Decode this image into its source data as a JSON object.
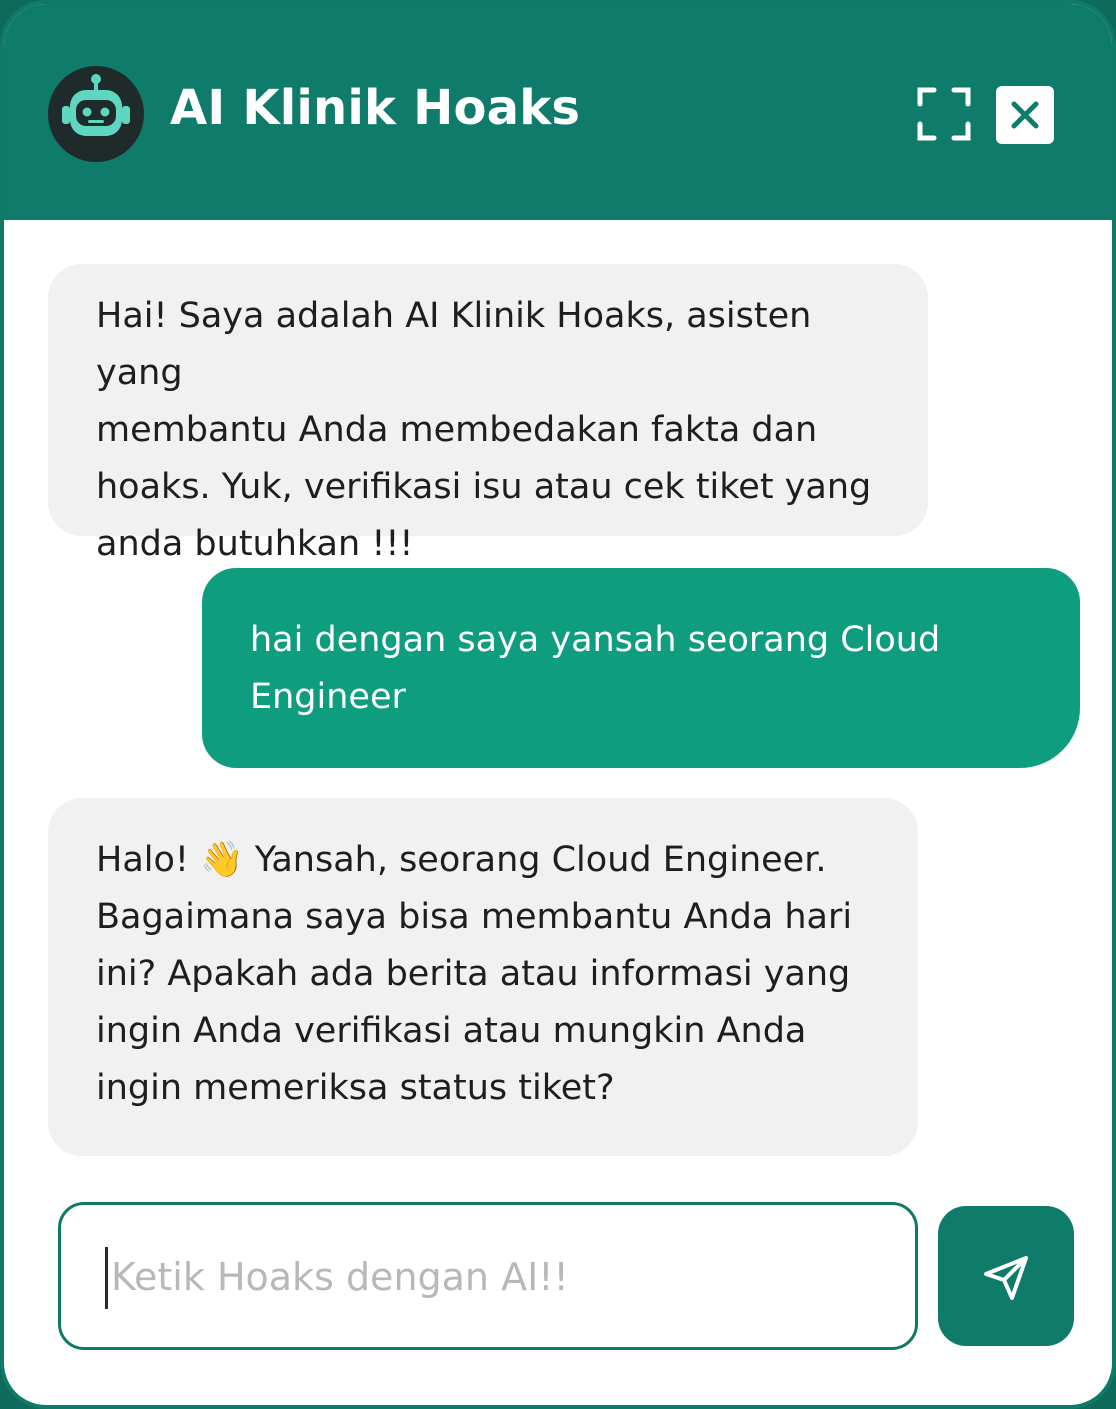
{
  "header": {
    "title": "AI Klinik Hoaks",
    "avatar_icon": "robot-icon",
    "expand_icon": "fullscreen-icon",
    "close_icon": "close-icon"
  },
  "messages": [
    {
      "role": "bot",
      "text": "Hai! Saya adalah AI Klinik Hoaks, asisten yang\nmembantu Anda membedakan fakta dan\nhoaks. Yuk, verifikasi isu atau cek tiket yang\nanda butuhkan !!!"
    },
    {
      "role": "user",
      "text": "hai dengan saya yansah seorang Cloud\nEngineer"
    },
    {
      "role": "bot",
      "text": "Halo! 👋 Yansah, seorang Cloud Engineer.\nBagaimana saya bisa membantu Anda hari\nini? Apakah ada berita atau informasi yang\ningin Anda verifikasi atau mungkin Anda\ningin memeriksa status tiket?"
    }
  ],
  "composer": {
    "placeholder": "Ketik Hoaks dengan AI!!",
    "value": "",
    "send_icon": "send-icon"
  },
  "colors": {
    "header": "#0f7b6a",
    "user_bubble": "#0f9d7f",
    "bot_bubble": "#f0f1f0"
  }
}
